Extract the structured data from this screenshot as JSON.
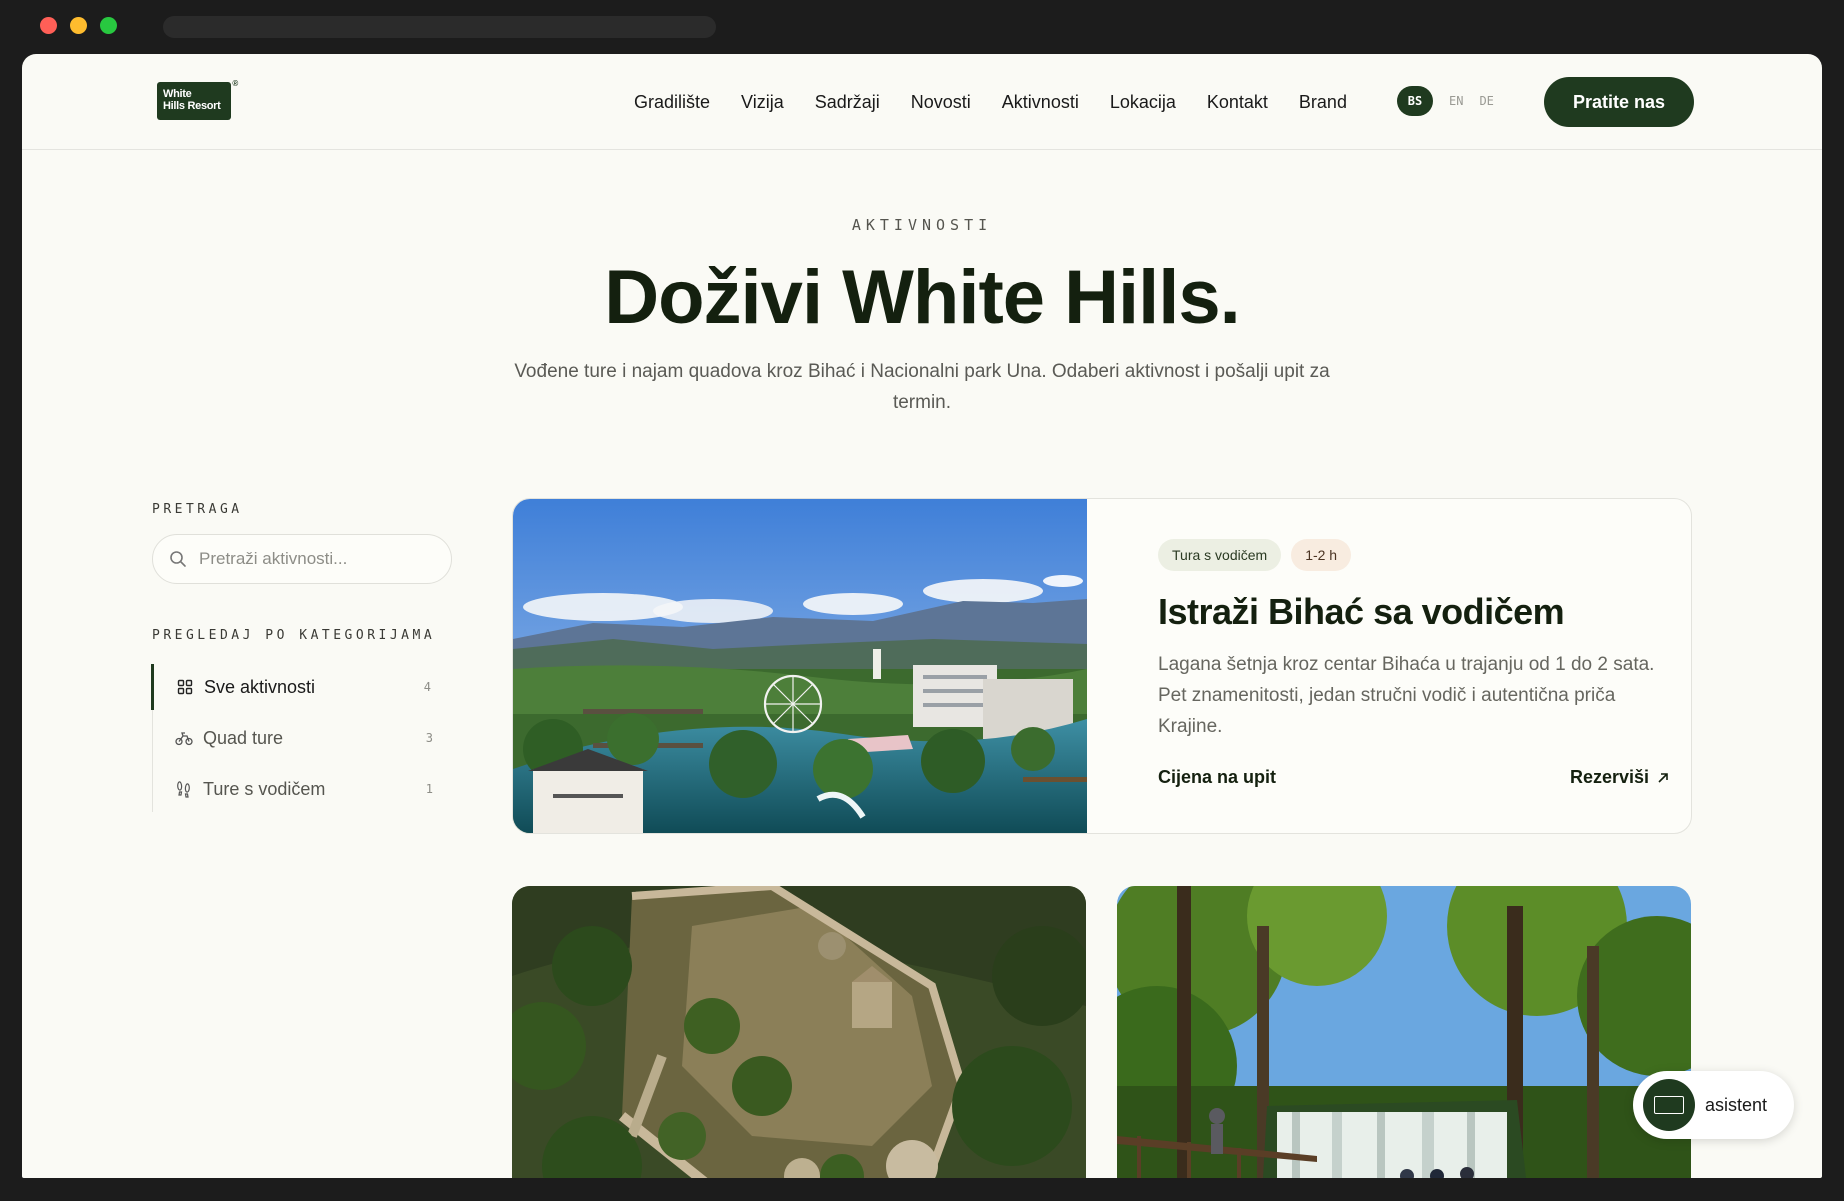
{
  "colors": {
    "brand": "#1f3a1f",
    "background": "#fafaf5",
    "chrome_red": "#ff5f57",
    "chrome_yellow": "#febc2e",
    "chrome_green": "#28c840"
  },
  "header": {
    "logo_line1": "White",
    "logo_line2": "Hills Resort",
    "logo_mark": "®",
    "nav": [
      "Gradilište",
      "Vizija",
      "Sadržaji",
      "Novosti",
      "Aktivnosti",
      "Lokacija",
      "Kontakt",
      "Brand"
    ],
    "languages": [
      "BS",
      "EN",
      "DE"
    ],
    "active_language": "BS",
    "follow_button": "Pratite nas"
  },
  "hero": {
    "eyebrow": "AKTIVNOSTI",
    "title": "Doživi White Hills.",
    "subtitle": "Vođene ture i najam quadova kroz Bihać i Nacionalni park Una. Odaberi aktivnost i pošalji upit za termin."
  },
  "sidebar": {
    "search_label": "PRETRAGA",
    "search_placeholder": "Pretraži aktivnosti...",
    "categories_label": "PREGLEDAJ PO KATEGORIJAMA",
    "categories": [
      {
        "label": "Sve aktivnosti",
        "count": "4",
        "icon": "grid-icon",
        "active": true
      },
      {
        "label": "Quad ture",
        "count": "3",
        "icon": "quad-icon",
        "active": false
      },
      {
        "label": "Ture s vodičem",
        "count": "1",
        "icon": "footprints-icon",
        "active": false
      }
    ]
  },
  "featured": {
    "badges": [
      "Tura s vodičem",
      "1-2 h"
    ],
    "title": "Istraži Bihać sa vodičem",
    "description": "Lagana šetnja kroz centar Bihaća u trajanju od 1 do 2 sata. Pet znamenitosti, jedan stručni vodič i autentična priča Krajine.",
    "price": "Cijena na upit",
    "book_label": "Rezerviši",
    "image": "bihac-river-city-photo"
  },
  "cards": [
    {
      "image": "fortress-aerial-photo"
    },
    {
      "image": "waterfall-forest-photo"
    }
  ],
  "assistant": {
    "label": "asistent"
  }
}
